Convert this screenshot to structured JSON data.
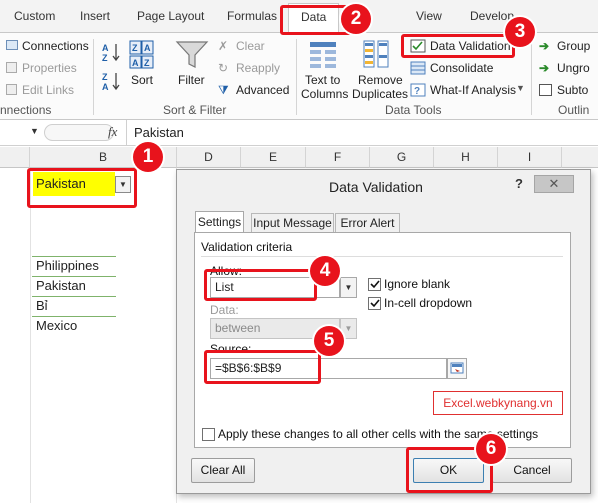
{
  "ribbon_tabs": [
    "Custom",
    "Insert",
    "Page Layout",
    "Formulas",
    "Data",
    "View",
    "Develop"
  ],
  "ribbon": {
    "connections": [
      "Connections",
      "Properties",
      "Edit Links"
    ],
    "connections_group": "nnections",
    "sort_asc": "A→Z",
    "sort_label": "Sort",
    "filter_label": "Filter",
    "filter_options": [
      "Clear",
      "Reapply",
      "Advanced"
    ],
    "sort_filter_group": "Sort & Filter",
    "text_to_columns": [
      "Text to",
      "Columns"
    ],
    "remove_duplicates": [
      "Remove",
      "Duplicates"
    ],
    "data_validation": "Data Validation",
    "consolidate": "Consolidate",
    "what_if": "What-If Analysis",
    "data_tools_group": "Data Tools",
    "group": "Group",
    "ungroup": "Ungro",
    "subtotal": "Subto",
    "outline_group": "Outlin"
  },
  "formula_bar": {
    "fx": "fx",
    "value": "Pakistan"
  },
  "sheet": {
    "columns": [
      "B",
      "D",
      "E",
      "F",
      "G",
      "H",
      "I"
    ],
    "selected_cell": "Pakistan",
    "list": [
      "Philippines",
      "Pakistan",
      "Bỉ",
      "Mexico"
    ]
  },
  "dialog": {
    "title": "Data Validation",
    "help": "?",
    "tabs": [
      "Settings",
      "Input Message",
      "Error Alert"
    ],
    "criteria_label": "Validation criteria",
    "allow_label": "Allow:",
    "allow_value": "List",
    "data_label": "Data:",
    "data_value": "between",
    "ignore_blank": "Ignore blank",
    "in_cell_dropdown": "In-cell dropdown",
    "source_label": "Source:",
    "source_value": "=$B$6:$B$9",
    "watermark": "Excel.webkynang.vn",
    "apply_all": "Apply these changes to all other cells with the same settings",
    "clear_all": "Clear All",
    "ok": "OK",
    "cancel": "Cancel"
  },
  "step_badges": [
    "1",
    "2",
    "3",
    "4",
    "5",
    "6"
  ],
  "colors": {
    "annotation_red": "#e8131c",
    "cell_highlight": "#ffff00"
  }
}
